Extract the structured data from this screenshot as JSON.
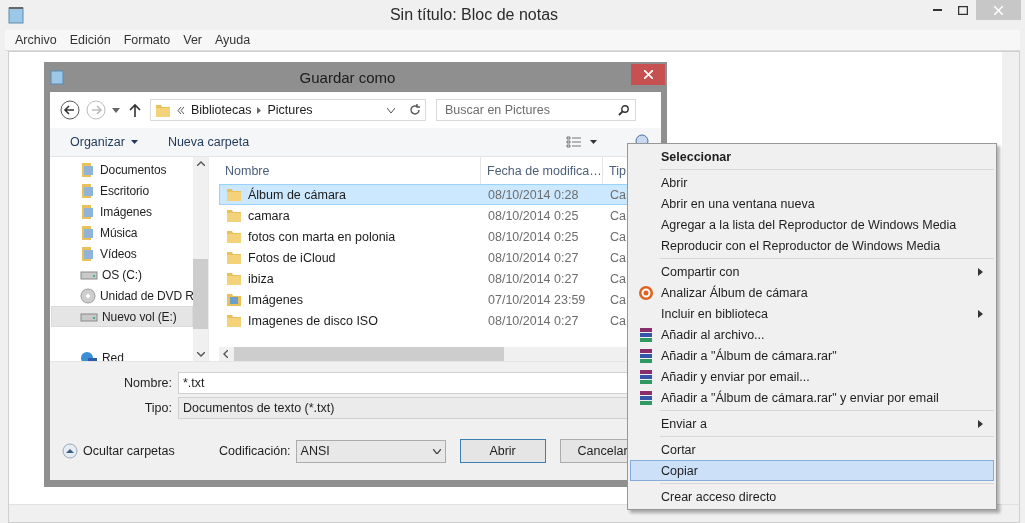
{
  "window": {
    "title": "Sin título: Bloc de notas"
  },
  "menu_bar": [
    "Archivo",
    "Edición",
    "Formato",
    "Ver",
    "Ayuda"
  ],
  "dialog": {
    "title": "Guardar como",
    "breadcrumb": [
      "Bibliotecas",
      "Pictures"
    ],
    "search": {
      "placeholder": "Buscar en Pictures"
    },
    "toolbar": [
      {
        "label": "Organizar",
        "kind": "menu"
      },
      {
        "label": "Nueva carpeta",
        "kind": "button"
      }
    ],
    "nav_items": [
      {
        "label": "Documentos",
        "kind": "library",
        "selected": false
      },
      {
        "label": "Escritorio",
        "kind": "library",
        "selected": false
      },
      {
        "label": "Imágenes",
        "kind": "library",
        "selected": false
      },
      {
        "label": "Música",
        "kind": "library",
        "selected": false
      },
      {
        "label": "Vídeos",
        "kind": "library",
        "selected": false
      },
      {
        "label": "OS (C:)",
        "kind": "drive",
        "selected": false
      },
      {
        "label": "Unidad de DVD R",
        "kind": "dvd",
        "selected": false
      },
      {
        "label": "Nuevo vol (E:)",
        "kind": "drive",
        "selected": true
      },
      {
        "label": "Red",
        "kind": "network",
        "selected": false
      }
    ],
    "columns": [
      "Nombre",
      "Fecha de modifica…",
      "Tip"
    ],
    "files": [
      {
        "name": "Álbum de cámara",
        "date": "08/10/2014 0:28",
        "type": "Ca",
        "kind": "folder",
        "selected": true
      },
      {
        "name": "camara",
        "date": "08/10/2014 0:25",
        "type": "Ca",
        "kind": "folder",
        "selected": false
      },
      {
        "name": "fotos con marta en polonia",
        "date": "08/10/2014 0:25",
        "type": "Ca",
        "kind": "folder",
        "selected": false
      },
      {
        "name": "Fotos de iCloud",
        "date": "08/10/2014 0:27",
        "type": "Ca",
        "kind": "folder",
        "selected": false
      },
      {
        "name": "ibiza",
        "date": "08/10/2014 0:27",
        "type": "Ca",
        "kind": "folder",
        "selected": false
      },
      {
        "name": "Imágenes",
        "date": "07/10/2014 23:59",
        "type": "Ca",
        "kind": "library",
        "selected": false
      },
      {
        "name": "Imagenes de disco ISO",
        "date": "08/10/2014 0:27",
        "type": "Ca",
        "kind": "folder",
        "selected": false
      }
    ],
    "name_field": {
      "label": "Nombre:",
      "value": "*.txt"
    },
    "type_field": {
      "label": "Tipo:",
      "value": "Documentos de texto (*.txt)"
    },
    "hide_folders": "Ocultar carpetas",
    "encoding": {
      "label": "Codificación:",
      "value": "ANSI"
    },
    "buttons": [
      {
        "label": "Abrir",
        "default": true
      },
      {
        "label": "Cancelar",
        "default": false
      }
    ]
  },
  "context_menu": {
    "items": [
      {
        "kind": "item",
        "label": "Seleccionar",
        "bold": true,
        "selected": false
      },
      {
        "kind": "separator"
      },
      {
        "kind": "item",
        "label": "Abrir",
        "bold": false,
        "selected": false
      },
      {
        "kind": "item",
        "label": "Abrir en una ventana nueva",
        "bold": false,
        "selected": false
      },
      {
        "kind": "item",
        "label": "Agregar a la lista del Reproductor de Windows Media",
        "bold": false,
        "selected": false
      },
      {
        "kind": "item",
        "label": "Reproducir con el Reproductor de Windows Media",
        "bold": false,
        "selected": false
      },
      {
        "kind": "separator"
      },
      {
        "kind": "item",
        "label": "Compartir con",
        "bold": false,
        "submenu": true,
        "selected": false
      },
      {
        "kind": "scan",
        "label": "Analizar Álbum de cámara",
        "bold": false,
        "selected": false
      },
      {
        "kind": "item",
        "label": "Incluir en biblioteca",
        "bold": false,
        "submenu": true,
        "selected": false
      },
      {
        "kind": "archive",
        "label": "Añadir al archivo...",
        "bold": false,
        "selected": false
      },
      {
        "kind": "archive",
        "label": "Añadir a \"Álbum de cámara.rar\"",
        "bold": false,
        "selected": false
      },
      {
        "kind": "archive",
        "label": "Añadir y enviar por email...",
        "bold": false,
        "selected": false
      },
      {
        "kind": "archive",
        "label": "Añadir a \"Álbum de cámara.rar\" y enviar por email",
        "bold": false,
        "selected": false
      },
      {
        "kind": "separator"
      },
      {
        "kind": "item",
        "label": "Enviar a",
        "bold": false,
        "submenu": true,
        "selected": false
      },
      {
        "kind": "separator"
      },
      {
        "kind": "item",
        "label": "Cortar",
        "bold": false,
        "selected": false
      },
      {
        "kind": "item",
        "label": "Copiar",
        "bold": false,
        "selected": true
      },
      {
        "kind": "separator"
      },
      {
        "kind": "item",
        "label": "Crear acceso directo",
        "bold": false,
        "selected": false
      }
    ]
  }
}
